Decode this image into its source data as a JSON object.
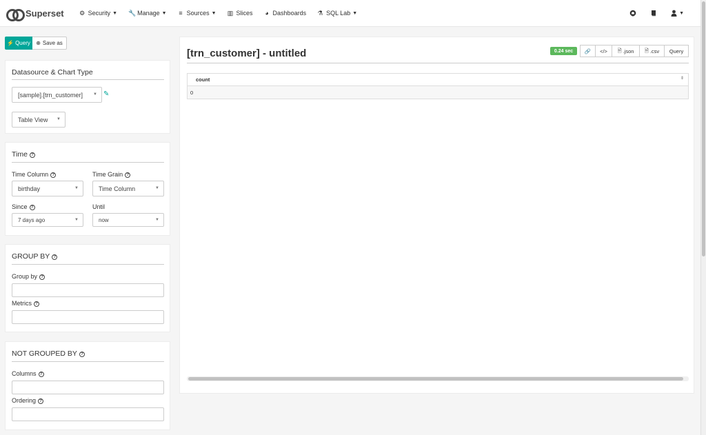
{
  "navbar": {
    "brand": "Superset",
    "items": [
      {
        "label": "Security",
        "icon": "cogs-icon",
        "dropdown": true
      },
      {
        "label": "Manage",
        "icon": "wrench-icon",
        "dropdown": true
      },
      {
        "label": "Sources",
        "icon": "database-icon",
        "dropdown": true
      },
      {
        "label": "Slices",
        "icon": "bar-chart-icon",
        "dropdown": false
      },
      {
        "label": "Dashboards",
        "icon": "dashboard-icon",
        "dropdown": false
      },
      {
        "label": "SQL Lab",
        "icon": "flask-icon",
        "dropdown": true
      }
    ],
    "right_icons": [
      "github-icon",
      "book-icon",
      "user-icon"
    ]
  },
  "toolbar": {
    "query_label": "Query",
    "save_as_label": "Save as"
  },
  "datasource_panel": {
    "title": "Datasource & Chart Type",
    "datasource_value": "[sample].[trn_customer]",
    "viz_type_value": "Table View"
  },
  "time_panel": {
    "title": "Time",
    "time_column_label": "Time Column",
    "time_column_value": "birthday",
    "time_grain_label": "Time Grain",
    "time_grain_value": "Time Column",
    "since_label": "Since",
    "since_value": "7 days ago",
    "until_label": "Until",
    "until_value": "now"
  },
  "group_by_panel": {
    "title": "GROUP BY",
    "group_by_label": "Group by",
    "metrics_label": "Metrics"
  },
  "not_grouped_panel": {
    "title": "NOT GROUPED BY",
    "columns_label": "Columns",
    "ordering_label": "Ordering"
  },
  "main": {
    "title": "[trn_customer] - untitled",
    "query_time": "0.24 sec",
    "buttons": {
      "json": ".json",
      "csv": ".csv",
      "query": "Query"
    },
    "table": {
      "columns": [
        "count"
      ],
      "rows": [
        [
          "0"
        ]
      ]
    }
  },
  "colors": {
    "accent": "#00a699",
    "success": "#5cb85c"
  }
}
